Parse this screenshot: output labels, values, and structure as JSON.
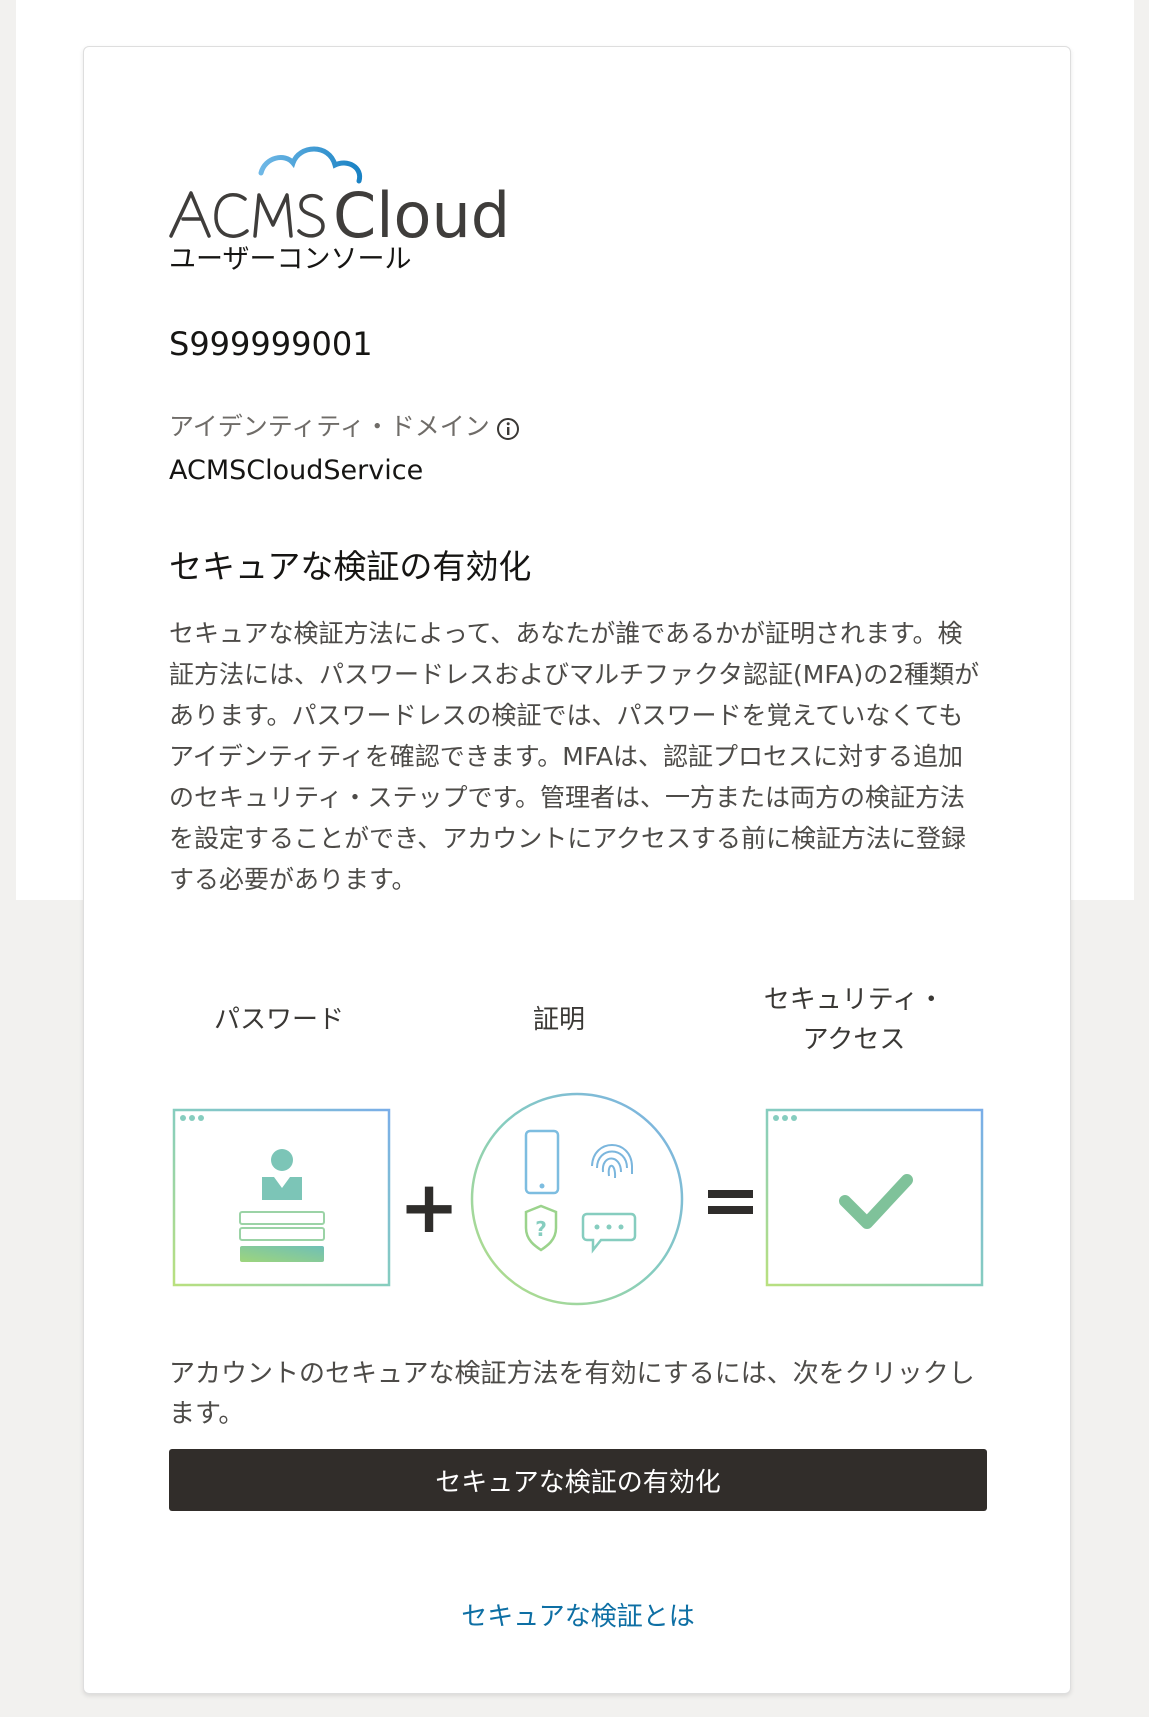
{
  "logo": {
    "text_acms": "ACMS",
    "text_cloud": "Cloud",
    "accent_color": "#1a82c4"
  },
  "app_name": "ユーザーコンソール",
  "tenant_id": "S999999001",
  "identity_domain": {
    "label": "アイデンティティ・ドメイン",
    "value": "ACMSCloudService",
    "info_icon": "info-circle-icon"
  },
  "section": {
    "title": "セキュアな検証の有効化",
    "description": "セキュアな検証方法によって、あなたが誰であるかが証明されます。検証方法には、パスワードレスおよびマルチファクタ認証(MFA)の2種類があります。パスワードレスの検証では、パスワードを覚えていなくてもアイデンティティを確認できます。MFAは、認証プロセスに対する追加のセキュリティ・ステップです。管理者は、一方または両方の検証方法を設定することができ、アカウントにアクセスする前に検証方法に登録する必要があります。"
  },
  "diagram": {
    "password_label": "パスワード",
    "proof_label": "証明",
    "access_label": "セキュリティ・\nアクセス",
    "plus": "+",
    "equals": "=",
    "gradient_colors": [
      "#b6df7e",
      "#7ec9c8",
      "#7aaee8"
    ]
  },
  "instruction": "アカウントのセキュアな検証方法を有効にするには、次をクリックします。",
  "actions": {
    "enable_button": "セキュアな検証の有効化",
    "help_link": "セキュアな検証とは"
  },
  "colors": {
    "button_bg": "#312d2a",
    "link": "#0e6fa4",
    "page_bg": "#f2f1ef"
  }
}
